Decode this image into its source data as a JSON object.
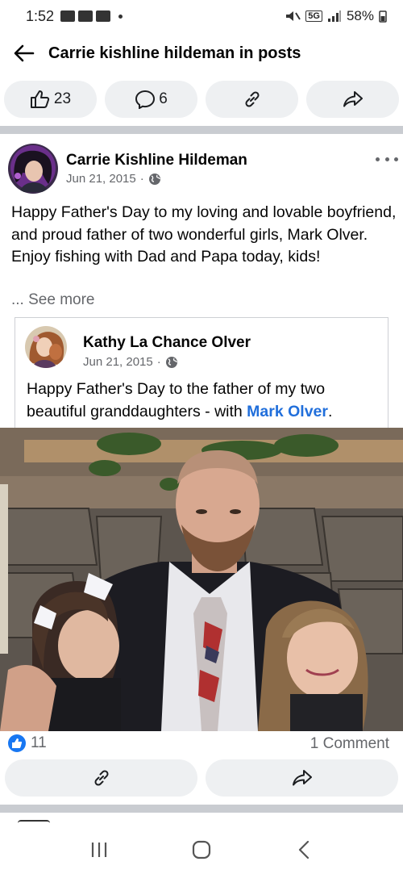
{
  "status_bar": {
    "time": "1:52",
    "network": "5G",
    "battery": "58%"
  },
  "header": {
    "title": "Carrie kishline hildeman in posts"
  },
  "actions": {
    "likes": "23",
    "comments": "6"
  },
  "post": {
    "author": "Carrie Kishline Hildeman",
    "date": "Jun 21, 2015",
    "text": "Happy Father's Day to my loving and lovable boyfriend, and proud father of two wonderful girls, Mark Olver. Enjoy fishing with Dad and Papa today, kids!",
    "see_more": "... See more",
    "shared": {
      "author": "Kathy La Chance Olver",
      "date": "Jun 21, 2015",
      "text_before": "Happy Father's Day to the father of my two beautiful  granddaughters - with ",
      "mention": "Mark Olver",
      "text_after": "."
    },
    "reaction_count": "11",
    "comment_count": "1 Comment"
  },
  "colors": {
    "accent": "#1877f2",
    "mention": "#216fdb",
    "pill_bg": "#eef0f2",
    "divider": "#c9ccd1"
  },
  "icons": [
    "back-arrow-icon",
    "thumbs-up-icon",
    "comment-icon",
    "link-icon",
    "share-icon",
    "globe-icon",
    "more-icon",
    "like-badge-icon",
    "recents-icon",
    "home-icon",
    "nav-back-icon"
  ]
}
